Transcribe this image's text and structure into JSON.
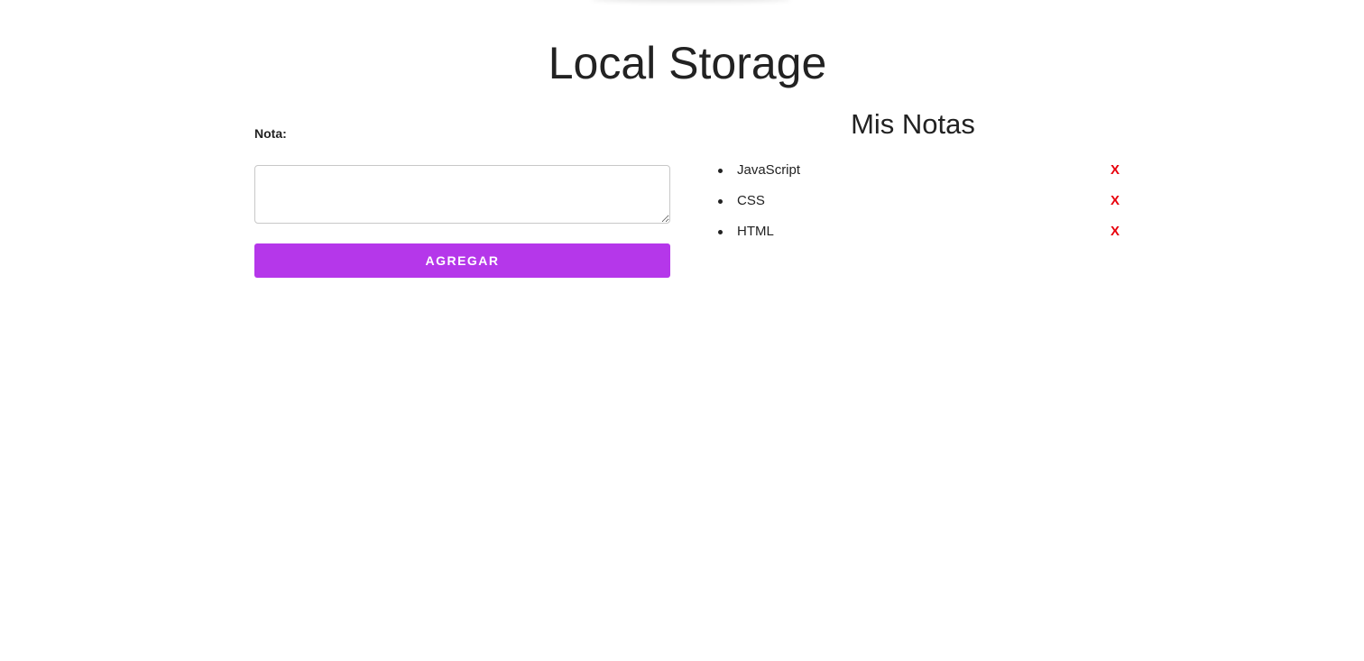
{
  "page": {
    "title": "Local Storage"
  },
  "form": {
    "label": "Nota:",
    "textarea_value": "",
    "textarea_placeholder": "",
    "submit_label": "AGREGAR"
  },
  "notes": {
    "title": "Mis Notas",
    "items": [
      {
        "text": "JavaScript",
        "delete_label": "X"
      },
      {
        "text": "CSS",
        "delete_label": "X"
      },
      {
        "text": "HTML",
        "delete_label": "X"
      }
    ]
  },
  "colors": {
    "accent": "#b537ea",
    "delete": "#e8000c",
    "text": "#222222"
  }
}
